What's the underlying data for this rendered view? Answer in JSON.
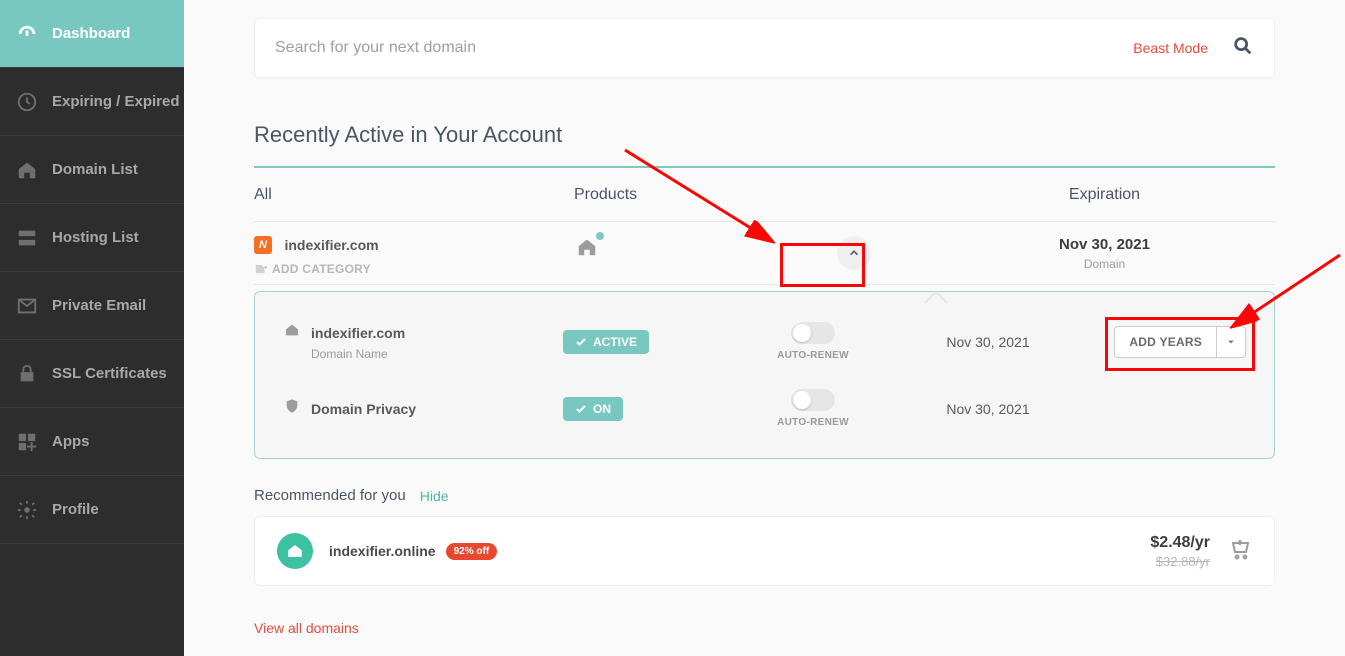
{
  "sidebar": {
    "items": [
      {
        "label": "Dashboard"
      },
      {
        "label": "Expiring / Expired"
      },
      {
        "label": "Domain List"
      },
      {
        "label": "Hosting List"
      },
      {
        "label": "Private Email"
      },
      {
        "label": "SSL Certificates"
      },
      {
        "label": "Apps"
      },
      {
        "label": "Profile"
      }
    ]
  },
  "search": {
    "placeholder": "Search for your next domain",
    "beast_label": "Beast Mode"
  },
  "section": {
    "recently_active_title": "Recently Active in Your Account",
    "cols": {
      "all": "All",
      "products": "Products",
      "expiration": "Expiration"
    }
  },
  "row": {
    "domain": "indexifier.com",
    "add_category": "ADD CATEGORY",
    "exp_date": "Nov 30, 2021",
    "exp_type": "Domain"
  },
  "panel": {
    "r1": {
      "name": "indexifier.com",
      "sub": "Domain Name",
      "badge": "ACTIVE",
      "switch_label": "AUTO-RENEW",
      "date": "Nov 30, 2021",
      "action": "ADD YEARS"
    },
    "r2": {
      "name": "Domain Privacy",
      "badge": "ON",
      "switch_label": "AUTO-RENEW",
      "date": "Nov 30, 2021"
    }
  },
  "reco": {
    "title": "Recommended for you",
    "hide": "Hide",
    "domain": "indexifier.online",
    "pill": "92% off",
    "price_now": "$2.48/yr",
    "price_old": "$32.88/yr"
  },
  "footer": {
    "view_all": "View all domains"
  }
}
